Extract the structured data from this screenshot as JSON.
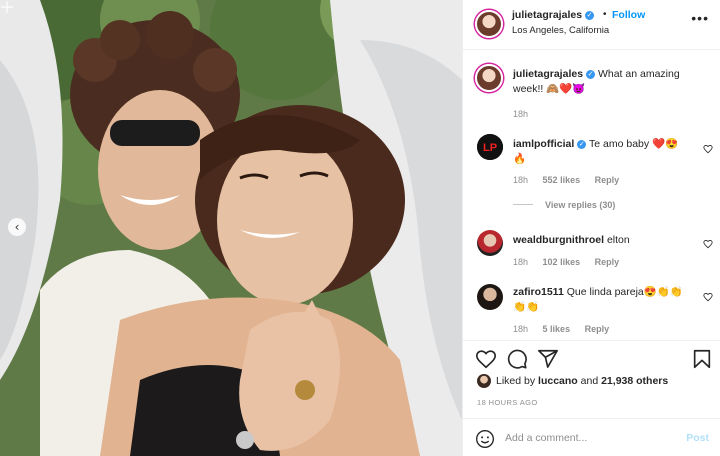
{
  "post": {
    "author": "julietagrajales",
    "follow_label": "Follow",
    "separator": "•",
    "location": "Los Angeles, California",
    "more_label": "•••"
  },
  "photo": {
    "description_icon": "photo",
    "prev_label": "‹"
  },
  "caption": {
    "author": "julietagrajales",
    "text": "What an amazing week!! 🙈❤️😈",
    "time": "18h"
  },
  "comments": [
    {
      "author": "iamlpofficial",
      "verified": true,
      "text": "Te amo baby ❤️😍🔥",
      "time": "18h",
      "likes": "552 likes",
      "reply": "Reply",
      "view_replies": "View replies (30)"
    },
    {
      "author": "wealdburgnithroel",
      "verified": false,
      "text": "elton",
      "time": "18h",
      "likes": "102 likes",
      "reply": "Reply"
    },
    {
      "author": "zafiro1511",
      "verified": false,
      "text": "Que linda pareja😍👏👏👏👏",
      "time": "18h",
      "likes": "5 likes",
      "reply": "Reply"
    }
  ],
  "likes": {
    "prefix": "Liked by",
    "user": "luccano",
    "joiner": "and",
    "others": "21,938 others"
  },
  "posted_ago": "18 HOURS AGO",
  "add_comment": {
    "placeholder": "Add a comment...",
    "post_label": "Post"
  },
  "colors": {
    "link_blue": "#0095f6",
    "verified_blue": "#3897f0",
    "muted": "#8e8e8e",
    "post_disabled": "#b2dffc"
  }
}
